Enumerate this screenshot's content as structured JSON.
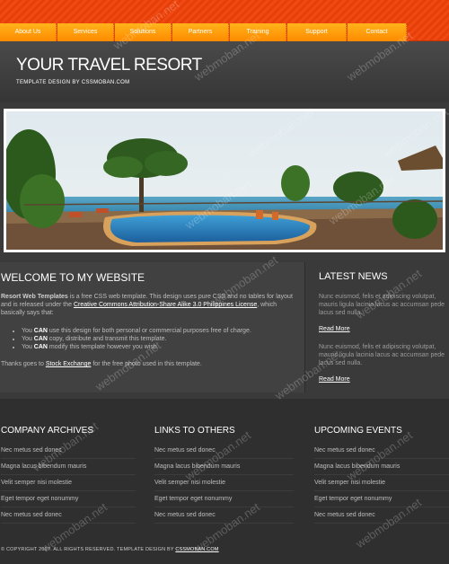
{
  "nav": [
    "About Us",
    "Services",
    "Solutions",
    "Partners",
    "Training",
    "Support",
    "Contact"
  ],
  "header": {
    "title": "YOUR TRAVEL RESORT",
    "tagline": "TEMPLATE DESIGN BY CSSMOBAN.COM"
  },
  "welcome": {
    "title": "WELCOME TO MY WEBSITE",
    "intro_bold": "Resort Web Templates",
    "intro_text": " is a free CSS web template. This design uses pure CSS and no tables for layout and is released under the ",
    "license_link": "Creative Commons Attribution-Share Alike 3.0 Philippines License",
    "intro_tail": ", which basically says that:",
    "bullets": [
      {
        "pre": "You ",
        "bold": "CAN",
        "post": " use this design for both personal or commercial purposes free of charge."
      },
      {
        "pre": "You ",
        "bold": "CAN",
        "post": " copy, distribute and transmit this template."
      },
      {
        "pre": "You ",
        "bold": "CAN",
        "post": " modify this template however you wish."
      }
    ],
    "thanks_pre": "Thanks goes to ",
    "thanks_link": "Stock Exchange",
    "thanks_post": " for the free photo used in this template."
  },
  "latest": {
    "title": "LATEST NEWS",
    "items": [
      {
        "text": "Nunc euismod, felis et adipiscing volutpat, mauris ligula lacinia lacus ac accumsan pede lacus sed nulla.",
        "link": "Read More"
      },
      {
        "text": "Nunc euismod, felis et adipiscing volutpat, mauris ligula lacinia lacus ac accumsan pede lacus sed nulla.",
        "link": "Read More"
      }
    ]
  },
  "columns": [
    {
      "title": "COMPANY ARCHIVES",
      "items": [
        "Nec metus sed donec",
        "Magna lacus bibendum mauris",
        "Velit semper nisi molestie",
        "Eget tempor eget nonummy",
        "Nec metus sed donec"
      ]
    },
    {
      "title": "LINKS TO OTHERS",
      "items": [
        "Nec metus sed donec",
        "Magna lacus bibendum mauris",
        "Velit semper nisi molestie",
        "Eget tempor eget nonummy",
        "Nec metus sed donec"
      ]
    },
    {
      "title": "UPCOMING EVENTS",
      "items": [
        "Nec metus sed donec",
        "Magna lacus bibendum mauris",
        "Velit semper nisi molestie",
        "Eget tempor eget nonummy",
        "Nec metus sed donec"
      ]
    }
  ],
  "footer": {
    "text": "© COPYRIGHT 2007. ALL RIGHTS RESERVED. TEMPLATE DESIGN BY ",
    "link": "CSSMOBAN.COM"
  },
  "watermark": "webmoban.net",
  "colors": {
    "accent": "#ff9a00",
    "topbar": "#f04a12",
    "bg": "#3a3a3a"
  }
}
